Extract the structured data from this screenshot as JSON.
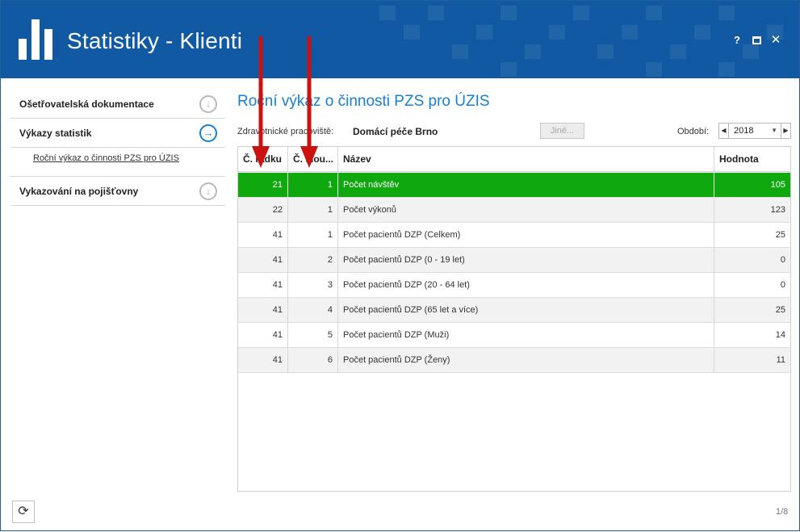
{
  "window": {
    "title": "Statistiky - Klienti",
    "help_label": "?",
    "close_label": "✕"
  },
  "sidebar": {
    "sections": [
      {
        "label": "Ošetřovatelská dokumentace",
        "icon": "arrow-down-circle-icon",
        "glyph": "↓"
      },
      {
        "label": "Výkazy statistik",
        "icon": "arrow-right-circle-icon",
        "glyph": "→"
      },
      {
        "label": "Vykazování na pojišťovny",
        "icon": "arrow-down-circle-icon",
        "glyph": "↓"
      }
    ],
    "sub_item": "Roční výkaz o činnosti PZS pro ÚZIS"
  },
  "main": {
    "title": "Roční výkaz o činnosti PZS pro ÚZIS",
    "filter_label": "Zdravotnické pracoviště:",
    "filter_value": "Domácí péče Brno",
    "other_button": "Jiné...",
    "period_label": "Období:",
    "period_value": "2018"
  },
  "table": {
    "columns": [
      "Č. řádku",
      "Č. slou...",
      "Název",
      "Hodnota"
    ],
    "rows": [
      {
        "row": "21",
        "col": "1",
        "name": "Počet návštěv",
        "value": "105",
        "selected": true
      },
      {
        "row": "22",
        "col": "1",
        "name": "Počet výkonů",
        "value": "123"
      },
      {
        "row": "41",
        "col": "1",
        "name": "Počet pacientů DZP (Celkem)",
        "value": "25"
      },
      {
        "row": "41",
        "col": "2",
        "name": "Počet pacientů DZP (0 - 19 let)",
        "value": "0"
      },
      {
        "row": "41",
        "col": "3",
        "name": "Počet pacientů DZP (20 - 64 let)",
        "value": "0"
      },
      {
        "row": "41",
        "col": "4",
        "name": "Počet pacientů DZP (65 let a více)",
        "value": "25"
      },
      {
        "row": "41",
        "col": "5",
        "name": "Počet pacientů DZP (Muži)",
        "value": "14"
      },
      {
        "row": "41",
        "col": "6",
        "name": "Počet pacientů DZP (Ženy)",
        "value": "11"
      }
    ]
  },
  "footer": {
    "pager": "1/8"
  },
  "colors": {
    "header": "#115aa3",
    "accent": "#1581d0",
    "selected_row": "#0fa80f",
    "annotation_arrow": "#cc1111"
  }
}
